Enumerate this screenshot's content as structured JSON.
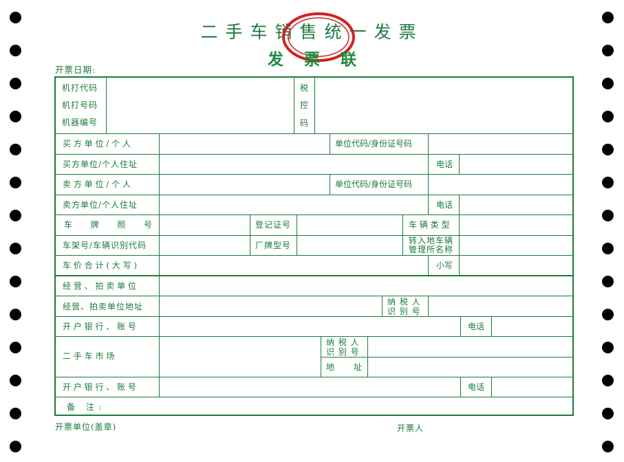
{
  "title": "二手车销售统一发票",
  "subtitle": "发票联",
  "colors": {
    "ink": "#1a7a3a",
    "seal": "#d02020",
    "holes": "#000000"
  },
  "invoice_date_label": "开票日期:",
  "header": {
    "machine_code": "机打代码",
    "machine_number": "机打号码",
    "machine_serial": "机器编号",
    "tax_control_1": "税",
    "tax_control_2": "控",
    "tax_control_3": "码"
  },
  "rows": {
    "buyer": "买 方 单 位 / 个 人",
    "unit_code": "单位代码/身份证号码",
    "buyer_address": "买方单位/个人住址",
    "phone": "电话",
    "seller": "卖 方 单 位 / 个 人",
    "seller_address": "卖方单位/个人住址",
    "plate_number": "车 牌 照 号",
    "registration_no": "登记证号",
    "vehicle_type": "车 辆 类 型",
    "vin": "车架号/车辆识别代码",
    "model": "厂牌型号",
    "transfer_office_1": "转入地车辆",
    "transfer_office_2": "管理所名称",
    "total_price": "车 价 合 计 ( 大 写 )",
    "small_letter": "小写",
    "auction_unit": "经 营 、 拍 卖 单 位",
    "auction_address": "经营、拍卖单位地址",
    "taxpayer_id_1": "纳 税 人",
    "taxpayer_id_2": "识 别 号",
    "bank_account": "开 户 银 行 、 账 号",
    "market": "二 手 车 市 场",
    "address": "地 址",
    "remarks": "备 注:"
  },
  "footer": {
    "issuer_unit": "开票单位(盖章)",
    "issuer": "开票人"
  }
}
